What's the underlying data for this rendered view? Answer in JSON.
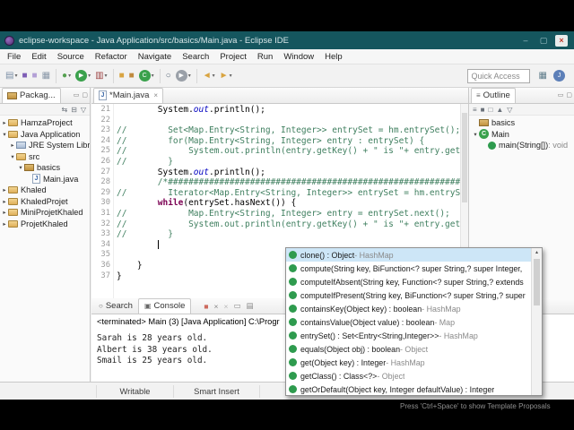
{
  "colors": {
    "titlebar": "#15565E",
    "comment_green": "#3F7F5F",
    "keyword_purple": "#7B0052",
    "static_field_blue": "#0000C0",
    "selection_blue": "#CDE6F7",
    "method_icon_green": "#2E9B4E"
  },
  "icons": {
    "dropdown": "▾",
    "twist_open": "▾",
    "twist_closed": "▸",
    "minimize": "–",
    "maximize": "▢",
    "close": "×",
    "view_minimize": "▭",
    "view_maximize": "▢",
    "outline_glyph": "≡",
    "scroll_up": "▴",
    "jfile_letter": "J",
    "class_letter": "C"
  },
  "chrome": {
    "title": "eclipse-workspace - Java Application/src/basics/Main.java - Eclipse IDE",
    "menus": [
      "File",
      "Edit",
      "Source",
      "Refactor",
      "Navigate",
      "Search",
      "Project",
      "Run",
      "Window",
      "Help"
    ],
    "quick_access": "Quick Access",
    "hint": "Press 'Ctrl+Space' to show Template Proposals"
  },
  "toolbar": {
    "items": [
      {
        "name": "new-wizard-icon",
        "g": "▤",
        "fg": "#7A8FA6",
        "drop": true
      },
      {
        "name": "save-icon",
        "g": "■",
        "fg": "#7E5DB5"
      },
      {
        "name": "save-all-icon",
        "g": "■",
        "fg": "#B3A0D6"
      },
      {
        "name": "print-icon",
        "g": "▦",
        "fg": "#8A98A8"
      },
      {
        "sep": true
      },
      {
        "name": "debug-icon",
        "g": "●",
        "fg": "#55A050",
        "drop": true
      },
      {
        "name": "run-icon",
        "g": "▶",
        "fg": "#FFFFFF",
        "bg": "#3AA14C",
        "round": true,
        "drop": true
      },
      {
        "name": "coverage-icon",
        "g": "▥",
        "fg": "#9E4444",
        "drop": true
      },
      {
        "sep": true
      },
      {
        "name": "new-java-project-icon",
        "g": "■",
        "fg": "#D9A441"
      },
      {
        "name": "new-package-icon",
        "g": "■",
        "fg": "#C08A3E"
      },
      {
        "name": "new-class-icon",
        "g": "C",
        "fg": "#FFFFFF",
        "bg": "#3AA14C",
        "round": true,
        "drop": true
      },
      {
        "sep": true
      },
      {
        "name": "search-icon",
        "g": "○",
        "fg": "#5A6B7A"
      },
      {
        "name": "external-tools-icon",
        "g": "▶",
        "fg": "#FFFFFF",
        "bg": "#9AA0A8",
        "round": true,
        "drop": true
      },
      {
        "sep": true
      },
      {
        "name": "back-icon",
        "g": "◄",
        "fg": "#D9A441",
        "drop": true
      },
      {
        "name": "forward-icon",
        "g": "►",
        "fg": "#D9A441",
        "drop": true
      }
    ],
    "right_items": [
      {
        "name": "open-perspective-icon",
        "g": "▦",
        "fg": "#607D8B"
      },
      {
        "name": "java-perspective-icon",
        "g": "J",
        "fg": "#FFFFFF",
        "bg": "#5C7FB8",
        "round": true
      }
    ]
  },
  "package_explorer": {
    "tab": "Packag...",
    "toolbar": [
      {
        "name": "link-with-editor-icon",
        "g": "⇆"
      },
      {
        "name": "collapse-all-icon",
        "g": "⊟"
      },
      {
        "name": "view-menu-icon",
        "g": "▽"
      }
    ],
    "items": [
      {
        "label": "HamzaProject",
        "icon": "folder",
        "indent": 0,
        "twist": "closed"
      },
      {
        "label": "Java Application",
        "icon": "folder",
        "indent": 0,
        "twist": "open"
      },
      {
        "label": "JRE System Libra",
        "icon": "lib",
        "indent": 1,
        "twist": "closed"
      },
      {
        "label": "src",
        "icon": "folder",
        "indent": 1,
        "twist": "open"
      },
      {
        "label": "basics",
        "icon": "pkg",
        "indent": 2,
        "twist": "open"
      },
      {
        "label": "Main.java",
        "icon": "jfile",
        "indent": 3,
        "twist": ""
      },
      {
        "label": "Khaled",
        "icon": "folder",
        "indent": 0,
        "twist": "closed"
      },
      {
        "label": "KhaledProjet",
        "icon": "folder",
        "indent": 0,
        "twist": "closed"
      },
      {
        "label": "MiniProjetKhaled",
        "icon": "folder",
        "indent": 0,
        "twist": "closed"
      },
      {
        "label": "ProjetKhaled",
        "icon": "folder",
        "indent": 0,
        "twist": "closed"
      }
    ]
  },
  "editor": {
    "tab": "*Main.java",
    "lines": [
      {
        "n": 21,
        "segs": [
          {
            "t": "        System.",
            "s": "p"
          },
          {
            "t": "out",
            "s": "st"
          },
          {
            "t": ".println();",
            "s": "p"
          }
        ]
      },
      {
        "n": 22,
        "segs": []
      },
      {
        "n": 23,
        "segs": [
          {
            "t": "//        Set<Map.Entry<String, Integer>> entrySet = hm.entrySet();",
            "s": "c"
          }
        ]
      },
      {
        "n": 24,
        "segs": [
          {
            "t": "//        for(Map.Entry<String, Integer> entry : entrySet) {",
            "s": "c"
          }
        ]
      },
      {
        "n": 25,
        "segs": [
          {
            "t": "//            System.out.println(entry.getKey() + \" is \"+ entry.getValue()",
            "s": "c"
          }
        ]
      },
      {
        "n": 26,
        "segs": [
          {
            "t": "//        }",
            "s": "c"
          }
        ]
      },
      {
        "n": 27,
        "segs": [
          {
            "t": "        System.",
            "s": "p"
          },
          {
            "t": "out",
            "s": "st"
          },
          {
            "t": ".println();",
            "s": "p"
          }
        ]
      },
      {
        "n": 28,
        "segs": [
          {
            "t": "        /*#########################################################*/",
            "s": "c"
          }
        ]
      },
      {
        "n": 29,
        "segs": [
          {
            "t": "//        Iterator<Map.Entry<String, Integer>> entrySet = hm.entrySet().ite",
            "s": "c"
          }
        ]
      },
      {
        "n": 30,
        "segs": [
          {
            "t": "        ",
            "s": "p"
          },
          {
            "t": "while",
            "s": "k"
          },
          {
            "t": "(entrySet.hasNext()) {",
            "s": "p"
          }
        ]
      },
      {
        "n": 31,
        "segs": [
          {
            "t": "//            Map.Entry<String, Integer> entry = entrySet.next();",
            "s": "c"
          }
        ]
      },
      {
        "n": 32,
        "segs": [
          {
            "t": "//            System.out.println(entry.getKey() + \" is \"+ entry.getValue()+",
            "s": "c"
          }
        ]
      },
      {
        "n": 33,
        "segs": [
          {
            "t": "//        }",
            "s": "c"
          }
        ]
      },
      {
        "n": 34,
        "segs": [
          {
            "t": "        ",
            "s": "p"
          }
        ],
        "cursor": true
      },
      {
        "n": 35,
        "segs": []
      },
      {
        "n": 36,
        "segs": [
          {
            "t": "    }",
            "s": "p"
          }
        ]
      },
      {
        "n": 37,
        "segs": [
          {
            "t": "}",
            "s": "p"
          }
        ]
      }
    ]
  },
  "outline": {
    "tab": "Outline",
    "toolbar": [
      {
        "name": "sort-icon",
        "g": "≡"
      },
      {
        "name": "hide-fields-icon",
        "g": "■"
      },
      {
        "name": "hide-static-icon",
        "g": "□"
      },
      {
        "name": "hide-non-public-icon",
        "g": "▲"
      },
      {
        "name": "view-menu-icon",
        "g": "▽"
      }
    ],
    "items": [
      {
        "label": "basics",
        "icon": "pkg",
        "indent": 0,
        "twist": ""
      },
      {
        "label": "Main",
        "icon": "class",
        "indent": 0,
        "twist": "open"
      },
      {
        "label": "main(String[])",
        "suffix": " : void",
        "icon": "method",
        "indent": 1,
        "twist": ""
      }
    ]
  },
  "console": {
    "tabs": [
      {
        "label": "Search",
        "glyph": "○",
        "active": false
      },
      {
        "label": "Console",
        "glyph": "▣",
        "active": true
      }
    ],
    "toolbar": [
      {
        "name": "terminate-icon",
        "g": "■",
        "fg": "#CD6A5E"
      },
      {
        "name": "remove-launch-icon",
        "g": "×",
        "fg": "#8A8A8A"
      },
      {
        "name": "remove-all-launches-icon",
        "g": "×",
        "fg": "#B9B9B9"
      },
      {
        "name": "clear-console-icon",
        "g": "▭",
        "fg": "#8A8A8A"
      },
      {
        "name": "scroll-lock-icon",
        "g": "▤",
        "fg": "#8A8A8A"
      }
    ],
    "terminated": "<terminated> Main (3) [Java Application] C:\\Progr",
    "output": [
      "Sarah is 28 years old.",
      "Albert is 38 years old.",
      "Smail is 25 years old."
    ]
  },
  "status": {
    "writable": "Writable",
    "insert_mode": "Smart Insert"
  },
  "popup": {
    "items": [
      {
        "sig": "clone() : Object",
        "from": "HashMap",
        "selected": true
      },
      {
        "sig": "compute(String key, BiFunction<? super String,? super Integer,",
        "from": ""
      },
      {
        "sig": "computeIfAbsent(String key, Function<? super String,? extends",
        "from": ""
      },
      {
        "sig": "computeIfPresent(String key, BiFunction<? super String,? super",
        "from": ""
      },
      {
        "sig": "containsKey(Object key) : boolean",
        "from": "HashMap"
      },
      {
        "sig": "containsValue(Object value) : boolean",
        "from": "Map"
      },
      {
        "sig": "entrySet() : Set<Entry<String,Integer>>",
        "from": "HashMap"
      },
      {
        "sig": "equals(Object obj) : boolean",
        "from": "Object"
      },
      {
        "sig": "get(Object key) : Integer",
        "from": "HashMap"
      },
      {
        "sig": "getClass() : Class<?>",
        "from": "Object"
      },
      {
        "sig": "getOrDefault(Object key, Integer defaultValue) : Integer",
        "from": ""
      }
    ]
  }
}
